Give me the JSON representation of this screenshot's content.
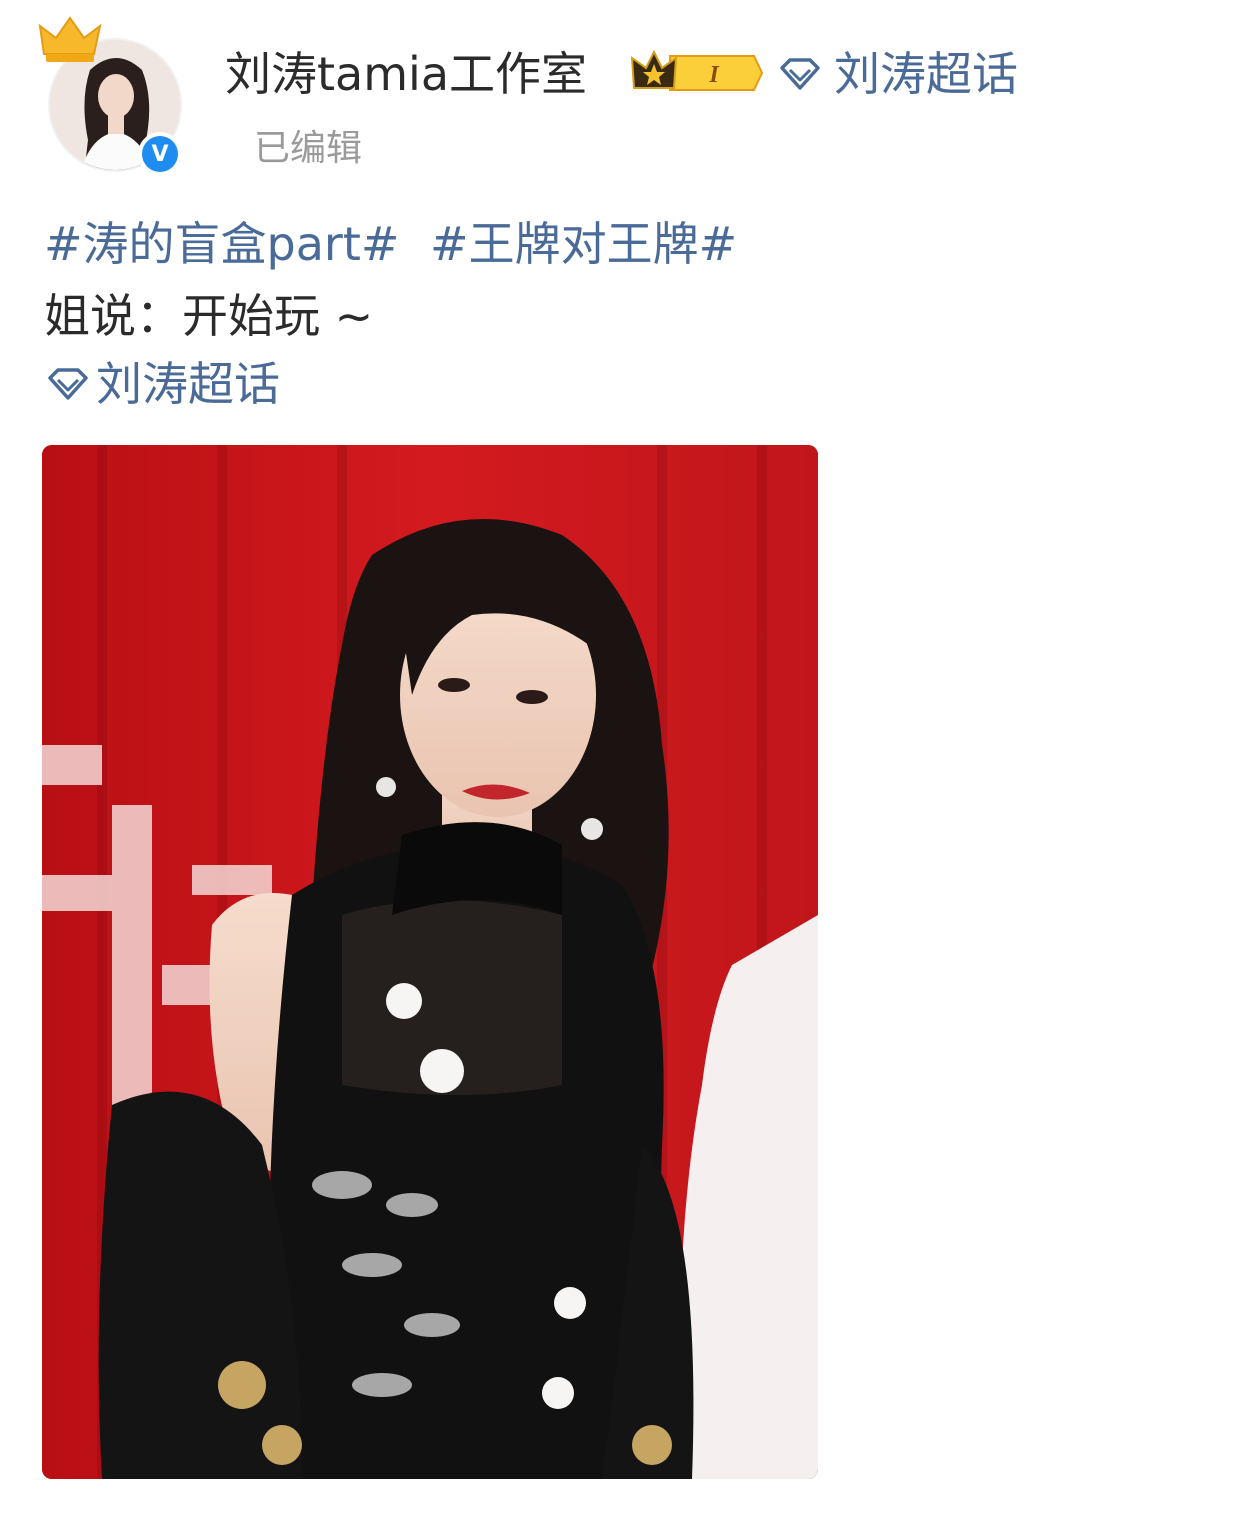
{
  "header": {
    "username": "刘涛tamia工作室",
    "vip_level_label": "I",
    "topic_label": "刘涛超话",
    "edited_label": "已编辑"
  },
  "post": {
    "hashtags": [
      "#涛的盲盒part#",
      "#王牌对王牌#"
    ],
    "text": "姐说：开始玩 ~",
    "topic_label": "刘涛超话"
  },
  "icons": {
    "crown": "crown-icon",
    "verified": "verified-v-icon",
    "vip_badge": "vip-crown-badge-icon",
    "topic": "diamond-topic-icon"
  },
  "colors": {
    "link": "#4a6a97",
    "verified": "#1e8cf0",
    "badge_gold": "#f5b623",
    "photo_bg": "#c4141a"
  }
}
